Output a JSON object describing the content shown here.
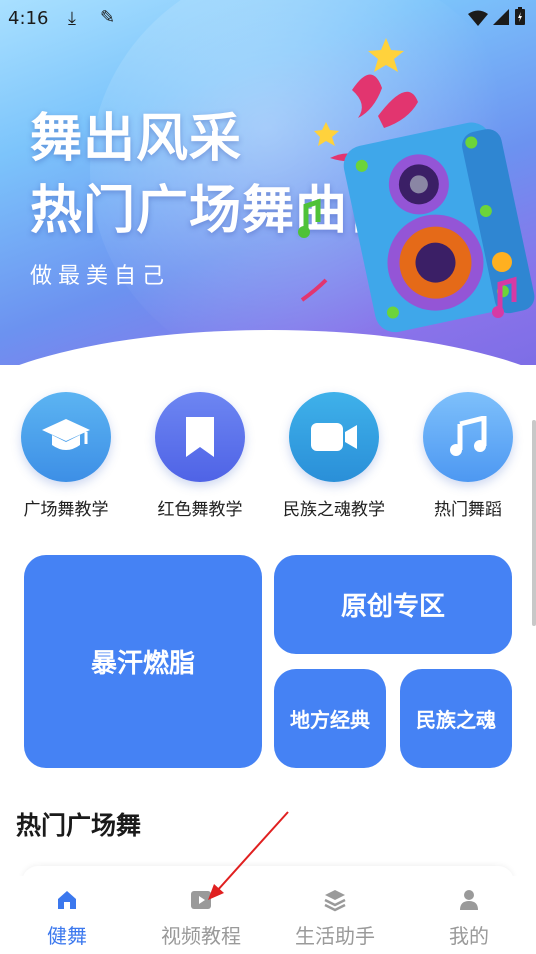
{
  "status_bar": {
    "time": "4:16",
    "icons": [
      "download-icon",
      "broom-icon",
      "wifi-icon",
      "signal-icon",
      "battery-icon"
    ]
  },
  "banner": {
    "title_line1": "舞出风采",
    "title_line2": "热门广场舞曲目",
    "subtitle": "做最美自己"
  },
  "categories": [
    {
      "label": "广场舞教学",
      "icon": "graduation-cap-icon",
      "color": "#4a9fee"
    },
    {
      "label": "红色舞教学",
      "icon": "bookmark-icon",
      "color": "#5a6fea"
    },
    {
      "label": "民族之魂教学",
      "icon": "video-camera-icon",
      "color": "#33a0e2"
    },
    {
      "label": "热门舞蹈",
      "icon": "music-note-icon",
      "color": "#62acf7"
    }
  ],
  "tiles": {
    "large": "暴汗燃脂",
    "top_right": "原创专区",
    "bottom_left": "地方经典",
    "bottom_right": "民族之魂"
  },
  "section": {
    "title": "热门广场舞"
  },
  "bottom_nav": [
    {
      "label": "健舞",
      "icon": "home-icon",
      "active": true
    },
    {
      "label": "视频教程",
      "icon": "play-video-icon",
      "active": false
    },
    {
      "label": "生活助手",
      "icon": "layers-icon",
      "active": false
    },
    {
      "label": "我的",
      "icon": "user-icon",
      "active": false
    }
  ],
  "colors": {
    "accent": "#4582f4",
    "nav_active": "#3c78ee",
    "nav_inactive": "#9a9a9a",
    "annotation_arrow": "#e02020"
  }
}
